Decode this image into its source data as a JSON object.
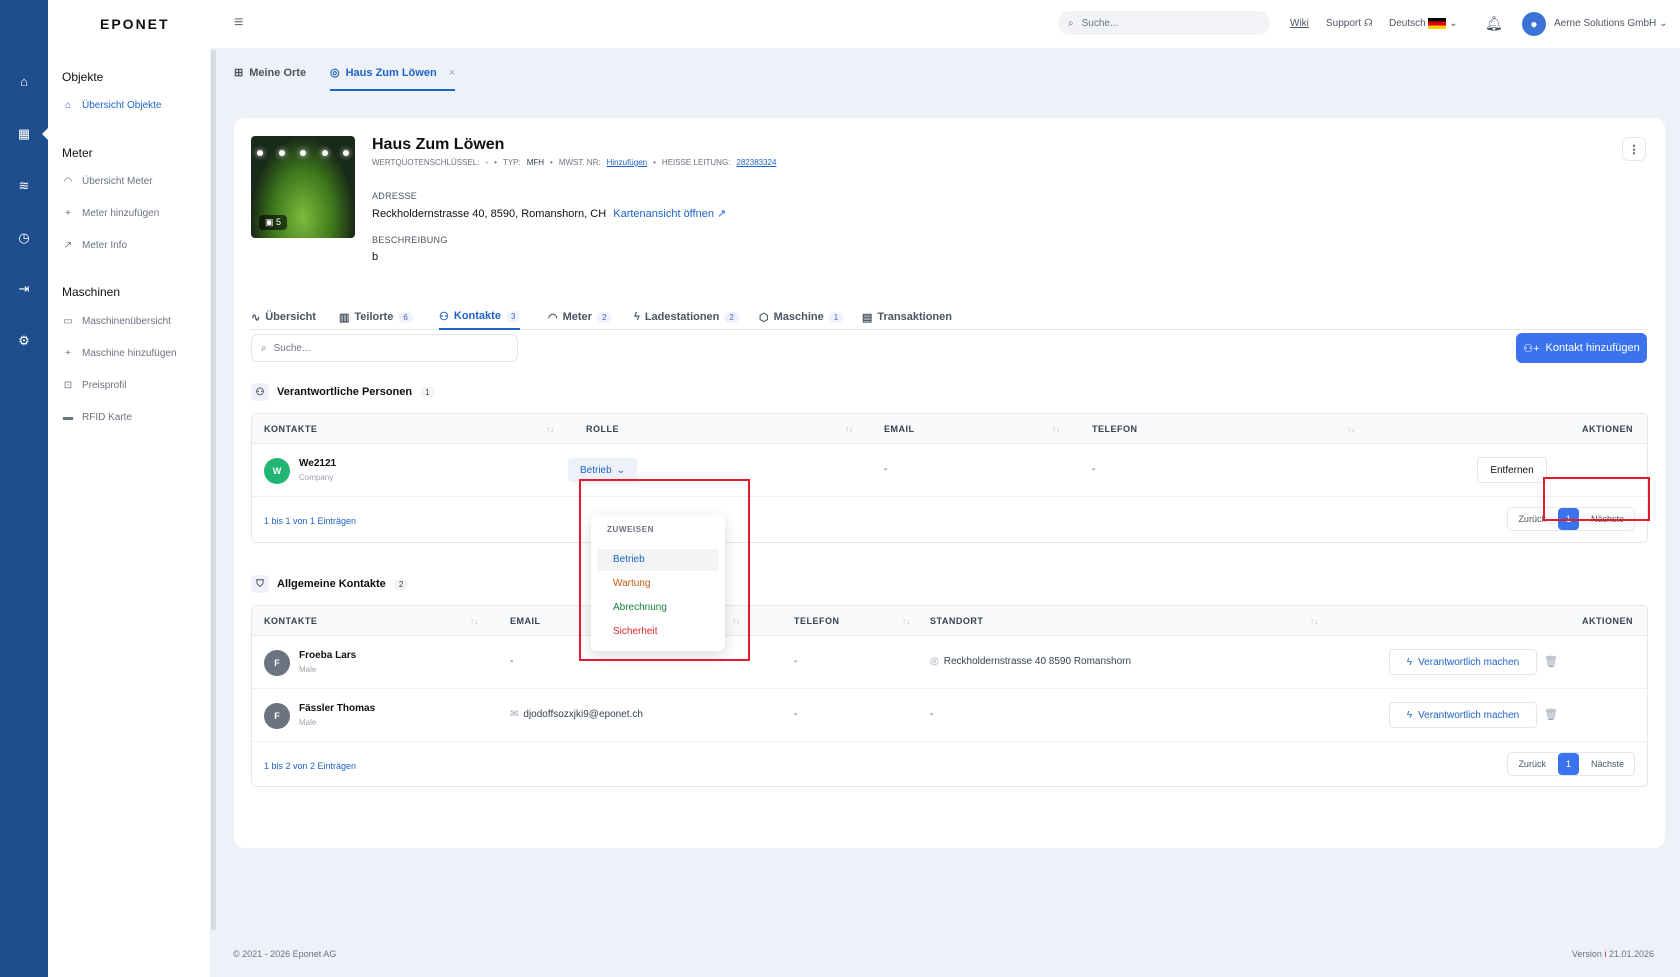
{
  "brand": "EPONET",
  "sidebar": {
    "sections": [
      {
        "title": "Objekte",
        "items": [
          {
            "label": "Übersicht Objekte"
          }
        ]
      },
      {
        "title": "Meter",
        "items": [
          {
            "label": "Übersicht Meter"
          },
          {
            "label": "Meter hinzufügen"
          },
          {
            "label": "Meter Info"
          }
        ]
      },
      {
        "title": "Maschinen",
        "items": [
          {
            "label": "Maschinenübersicht"
          },
          {
            "label": "Maschine hinzufügen"
          },
          {
            "label": "Preisprofil"
          },
          {
            "label": "RFID Karte"
          }
        ]
      }
    ]
  },
  "topbar": {
    "search_placeholder": "Suche...",
    "wiki": "Wiki",
    "support": "Support",
    "language": "Deutsch",
    "account": "Aerne Solutions GmbH"
  },
  "page_tabs": [
    {
      "label": "Meine Orte"
    },
    {
      "label": "Haus Zum Löwen"
    }
  ],
  "object": {
    "name": "Haus Zum Löwen",
    "photo_count": "5",
    "meta": {
      "wq_label": "WERTQUOTENSCHLÜSSEL:",
      "wq_value": "-",
      "typ_label": "TYP:",
      "typ_value": "MFH",
      "mwst_label": "MWST. NR:",
      "mwst_value": "Hinzufügen",
      "heisse_label": "HEISSE LEITUNG:",
      "heisse_value": "282383324"
    },
    "address_label": "ADRESSE",
    "address": "Reckholdernstrasse 40, 8590, Romanshorn, CH",
    "map_link": "Kartenansicht öffnen",
    "description_label": "BESCHREIBUNG",
    "description": "b"
  },
  "content_tabs": [
    {
      "label": "Übersicht",
      "badge": ""
    },
    {
      "label": "Teilorte",
      "badge": "6"
    },
    {
      "label": "Kontakte",
      "badge": "3"
    },
    {
      "label": "Meter",
      "badge": "2"
    },
    {
      "label": "Ladestationen",
      "badge": "2"
    },
    {
      "label": "Maschine",
      "badge": "1"
    },
    {
      "label": "Transaktionen",
      "badge": ""
    }
  ],
  "contacts": {
    "search_placeholder": "Suche...",
    "add_button": "Kontakt hinzufügen",
    "responsible": {
      "title": "Verantwortliche Personen",
      "count": "1",
      "columns": [
        "KONTAKTE",
        "ROLLE",
        "EMAIL",
        "TELEFON",
        "AKTIONEN"
      ],
      "rows": [
        {
          "initial": "W",
          "name": "We2121",
          "sub": "Company",
          "role": "Betrieb",
          "email": "-",
          "phone": "-",
          "action": "Entfernen"
        }
      ],
      "info": "1 bis 1 von 1 Einträgen"
    },
    "general": {
      "title": "Allgemeine Kontakte",
      "count": "2",
      "columns": [
        "KONTAKTE",
        "EMAIL",
        "TELEFON",
        "STANDORT",
        "AKTIONEN"
      ],
      "rows": [
        {
          "initial": "F",
          "name": "Froeba Lars",
          "sub": "Male",
          "email": "-",
          "phone": "-",
          "location": "Reckholdernstrasse 40 8590 Romanshorn",
          "action": "Verantwortlich machen"
        },
        {
          "initial": "F",
          "name": "Fässler Thomas",
          "sub": "Male",
          "email": "djodoffsozxjki9@eponet.ch",
          "phone": "-",
          "location": "-",
          "action": "Verantwortlich machen"
        }
      ],
      "info": "1 bis 2 von 2 Einträgen"
    },
    "pager": {
      "prev": "Zurück",
      "page": "1",
      "next": "Nächste"
    }
  },
  "role_dropdown": {
    "header": "ZUWEISEN",
    "options": [
      {
        "label": "Betrieb",
        "color": "#1d63c8"
      },
      {
        "label": "Wartung",
        "color": "#c2570c"
      },
      {
        "label": "Abrechnung",
        "color": "#15803d"
      },
      {
        "label": "Sicherheit",
        "color": "#dc2626"
      }
    ]
  },
  "footer": {
    "copyright": "© 2021 - 2026 Eponet AG",
    "version_label": "Version",
    "version_date": "21.01.2026"
  },
  "colors": {
    "rail": "#1e4e8c",
    "accent": "#3b73ee",
    "highlight": "#e11d2b"
  }
}
